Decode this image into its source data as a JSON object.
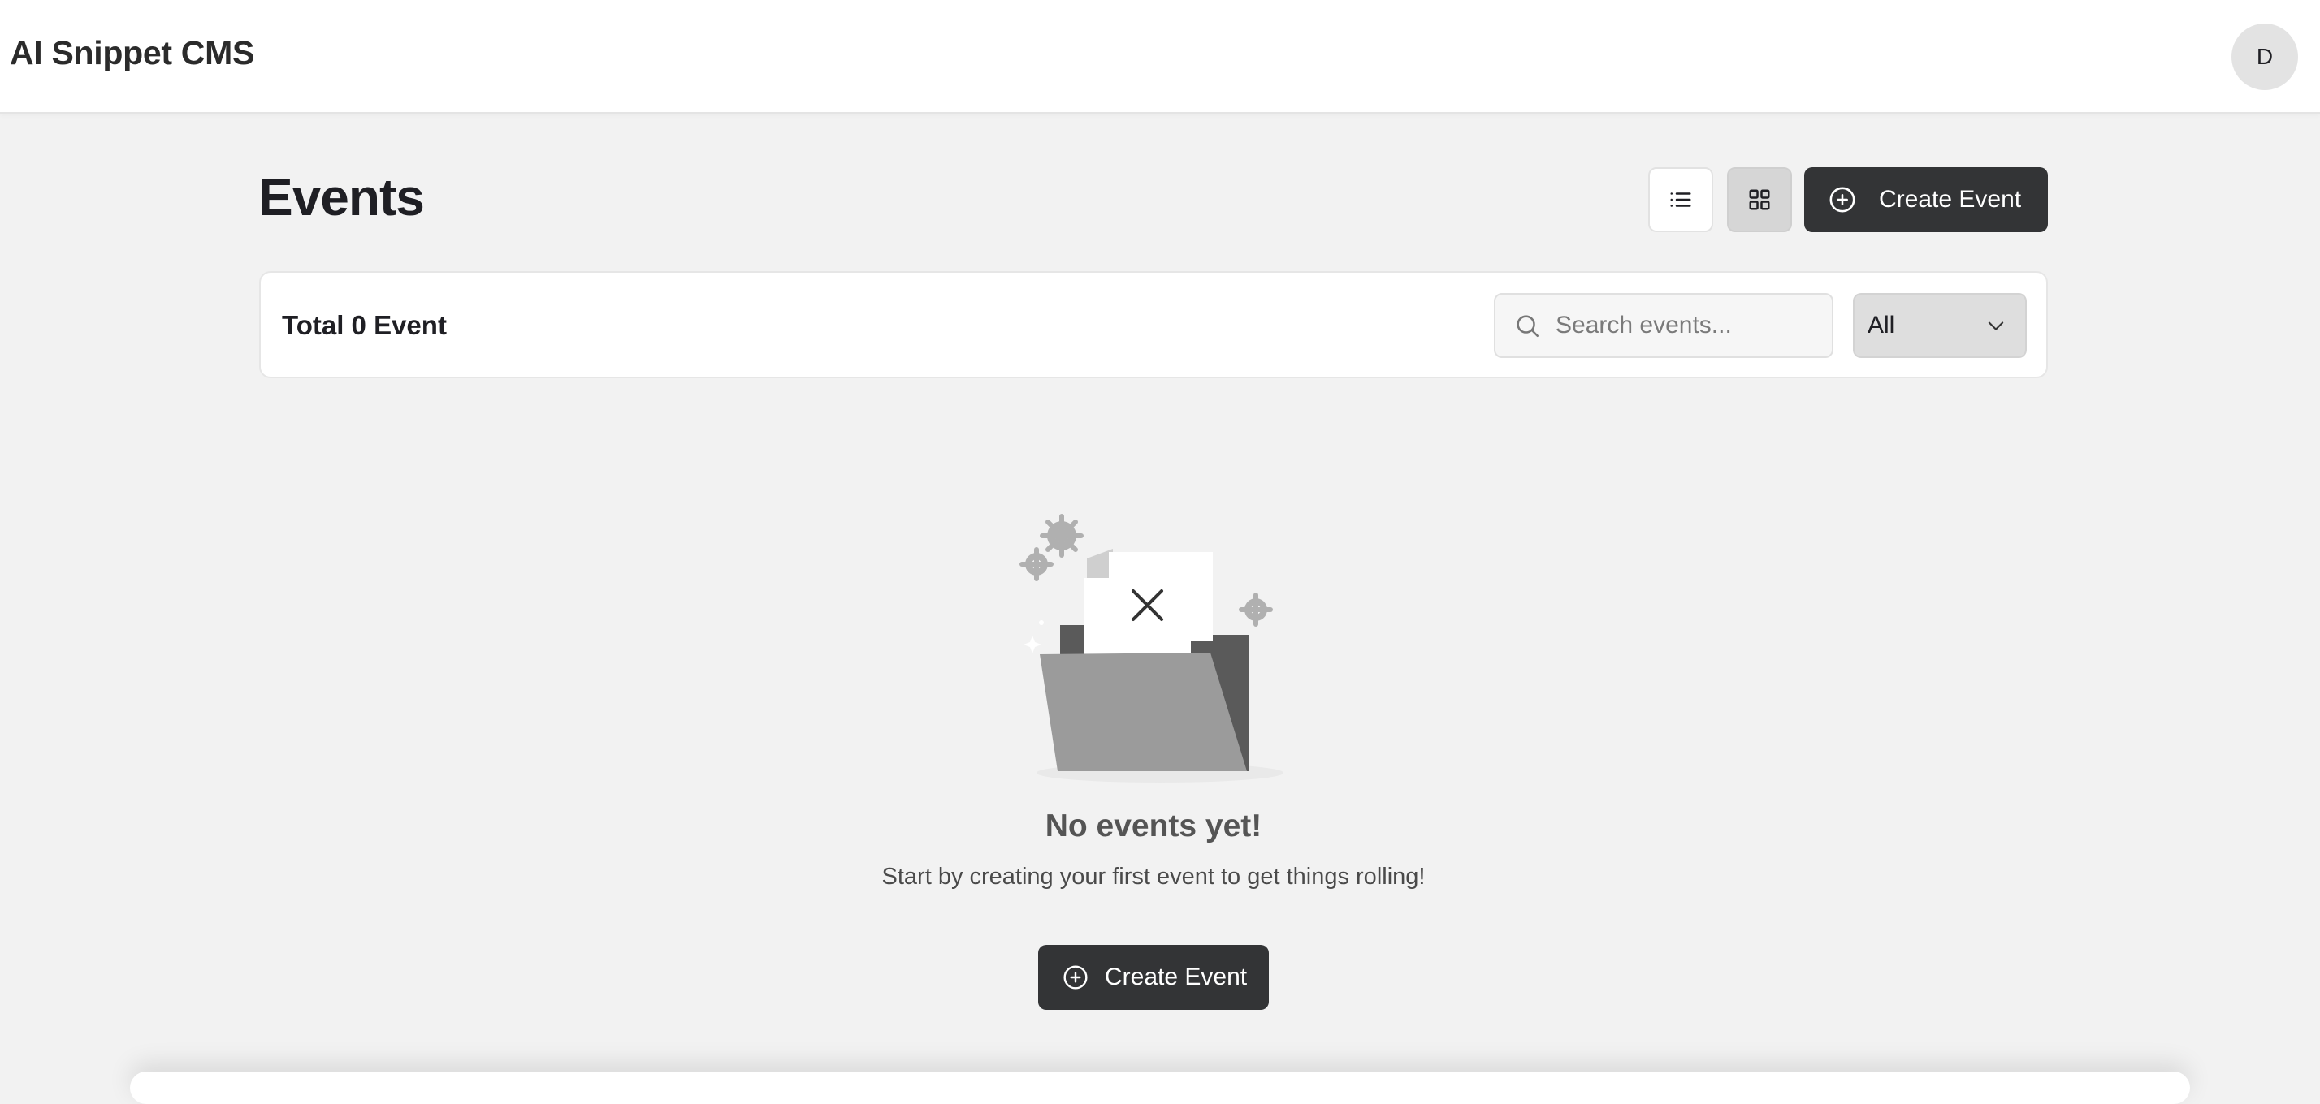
{
  "header": {
    "app_title": "AI Snippet CMS",
    "avatar_initial": "D"
  },
  "toolbar": {
    "page_title": "Events",
    "list_view_icon": "list-icon",
    "grid_view_icon": "grid-icon",
    "active_view": "grid",
    "create_button_label": "Create Event"
  },
  "filter_bar": {
    "total_label": "Total 0 Event",
    "search_placeholder": "Search events...",
    "search_value": "",
    "filter_selected": "All"
  },
  "empty_state": {
    "title": "No events yet!",
    "subtitle": "Start by creating your first event to get things rolling!",
    "button_label": "Create Event",
    "illustration_icon": "empty-folder-icon"
  },
  "colors": {
    "page_background": "#f2f2f2",
    "primary_button": "#333436",
    "surface": "#ffffff"
  }
}
